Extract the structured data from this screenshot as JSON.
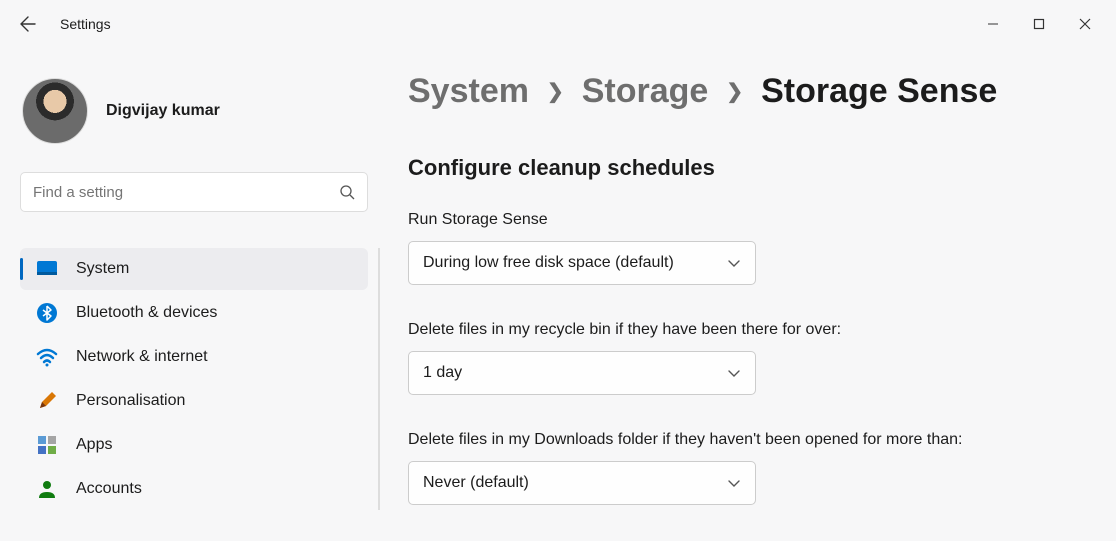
{
  "window": {
    "title": "Settings"
  },
  "profile": {
    "name": "Digvijay kumar",
    "sub": "                        "
  },
  "search": {
    "placeholder": "Find a setting"
  },
  "sidebar": {
    "items": [
      {
        "label": "System"
      },
      {
        "label": "Bluetooth & devices"
      },
      {
        "label": "Network & internet"
      },
      {
        "label": "Personalisation"
      },
      {
        "label": "Apps"
      },
      {
        "label": "Accounts"
      }
    ],
    "selected_index": 0
  },
  "breadcrumb": {
    "crumb1": "System",
    "crumb2": "Storage",
    "current": "Storage Sense"
  },
  "main": {
    "section_title": "Configure cleanup schedules",
    "run_label": "Run Storage Sense",
    "run_value": "During low free disk space (default)",
    "recycle_label": "Delete files in my recycle bin if they have been there for over:",
    "recycle_value": "1 day",
    "downloads_label": "Delete files in my Downloads folder if they haven't been opened for more than:",
    "downloads_value": "Never (default)"
  }
}
